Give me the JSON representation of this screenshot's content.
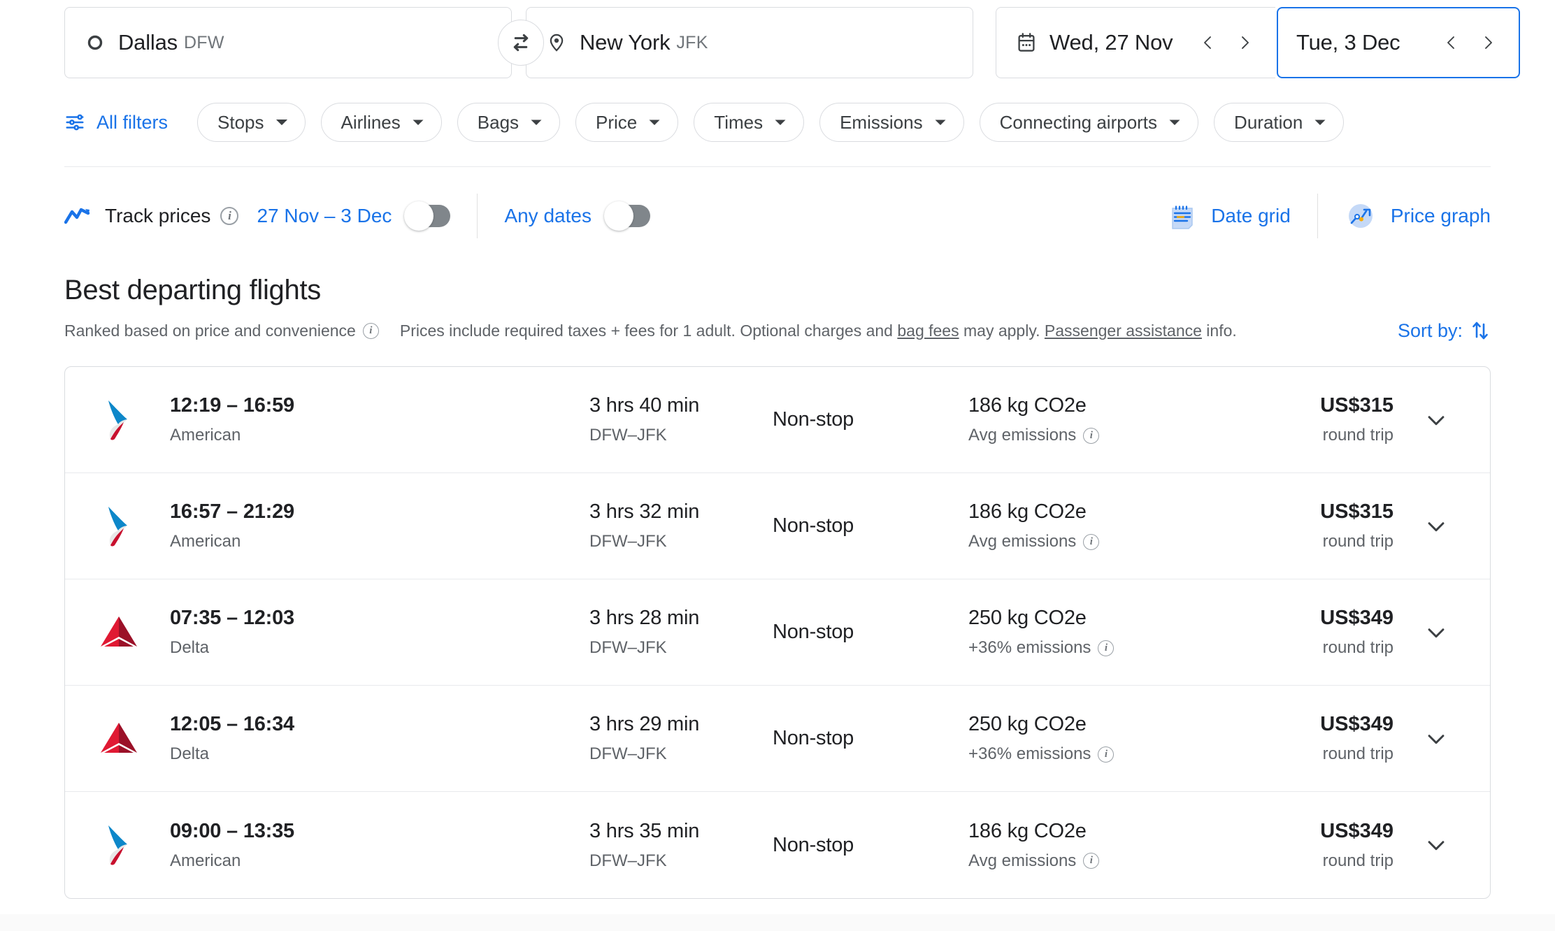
{
  "search": {
    "origin": {
      "city": "Dallas",
      "code": "DFW",
      "icon": "circle-outline-icon"
    },
    "destination": {
      "city": "New York",
      "code": "JFK",
      "icon": "location-pin-icon"
    },
    "swap_label": "swap-origin-destination",
    "depart_date": "Wed, 27 Nov",
    "return_date": "Tue, 3 Dec"
  },
  "filters": {
    "all_filters_label": "All filters",
    "chips": [
      {
        "label": "Stops"
      },
      {
        "label": "Airlines"
      },
      {
        "label": "Bags"
      },
      {
        "label": "Price"
      },
      {
        "label": "Times"
      },
      {
        "label": "Emissions"
      },
      {
        "label": "Connecting airports"
      },
      {
        "label": "Duration"
      }
    ]
  },
  "track": {
    "label": "Track prices",
    "dates": "27 Nov – 3 Dec",
    "any_dates_label": "Any dates",
    "date_grid_label": "Date grid",
    "price_graph_label": "Price graph",
    "track_toggle_on": false,
    "any_dates_toggle_on": false
  },
  "results": {
    "title": "Best departing flights",
    "ranked_note": "Ranked based on price and convenience",
    "prices_note_a": "Prices include required taxes + fees for 1 adult. Optional charges and ",
    "prices_note_link1": "bag fees",
    "prices_note_b": " may apply. ",
    "prices_note_link2": "Passenger assistance",
    "prices_note_c": " info.",
    "sort_by_label": "Sort by:",
    "flights": [
      {
        "airline": "American",
        "logo": "american-airlines-logo",
        "times": "12:19 – 16:59",
        "duration": "3 hrs 40 min",
        "route": "DFW–JFK",
        "stops": "Non-stop",
        "emissions": "186 kg CO2e",
        "emissions_note": "Avg emissions",
        "price": "US$315",
        "price_note": "round trip"
      },
      {
        "airline": "American",
        "logo": "american-airlines-logo",
        "times": "16:57 – 21:29",
        "duration": "3 hrs 32 min",
        "route": "DFW–JFK",
        "stops": "Non-stop",
        "emissions": "186 kg CO2e",
        "emissions_note": "Avg emissions",
        "price": "US$315",
        "price_note": "round trip"
      },
      {
        "airline": "Delta",
        "logo": "delta-airlines-logo",
        "times": "07:35 – 12:03",
        "duration": "3 hrs 28 min",
        "route": "DFW–JFK",
        "stops": "Non-stop",
        "emissions": "250 kg CO2e",
        "emissions_note": "+36% emissions",
        "price": "US$349",
        "price_note": "round trip"
      },
      {
        "airline": "Delta",
        "logo": "delta-airlines-logo",
        "times": "12:05 – 16:34",
        "duration": "3 hrs 29 min",
        "route": "DFW–JFK",
        "stops": "Non-stop",
        "emissions": "250 kg CO2e",
        "emissions_note": "+36% emissions",
        "price": "US$349",
        "price_note": "round trip"
      },
      {
        "airline": "American",
        "logo": "american-airlines-logo",
        "times": "09:00 – 13:35",
        "duration": "3 hrs 35 min",
        "route": "DFW–JFK",
        "stops": "Non-stop",
        "emissions": "186 kg CO2e",
        "emissions_note": "Avg emissions",
        "price": "US$349",
        "price_note": "round trip"
      }
    ]
  },
  "colors": {
    "accent": "#1a73e8",
    "text_primary": "#202124",
    "text_secondary": "#5f6368",
    "border": "#dadce0",
    "american_blue": "#0d87c9",
    "american_red": "#c8102e",
    "delta_red": "#e01933",
    "delta_dark": "#9b1128"
  }
}
